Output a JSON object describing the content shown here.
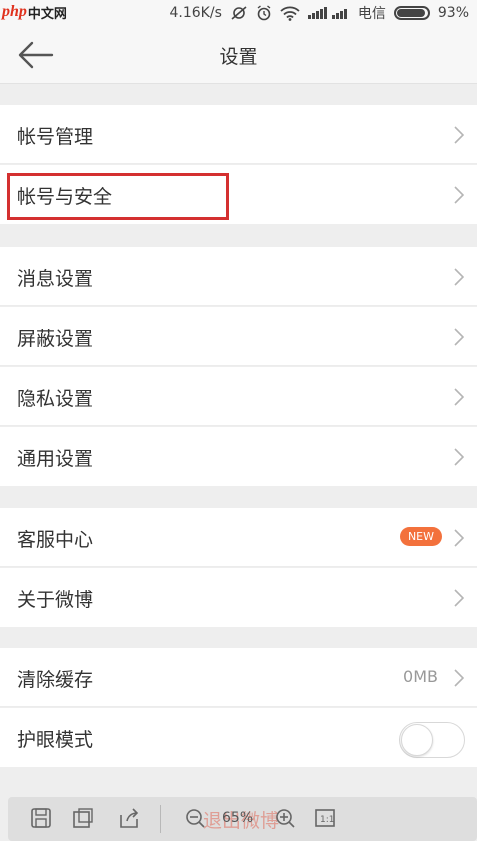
{
  "status_bar": {
    "logo_php": "php",
    "logo_cn": "中文网",
    "speed": "4.16K/s",
    "carrier": "电信",
    "battery": "93%"
  },
  "nav": {
    "title": "设置"
  },
  "settings": {
    "account_manage": "帐号管理",
    "account_security": "帐号与安全",
    "message_settings": "消息设置",
    "block_settings": "屏蔽设置",
    "privacy_settings": "隐私设置",
    "general_settings": "通用设置",
    "customer_service": "客服中心",
    "customer_service_badge": "NEW",
    "about_weibo": "关于微博",
    "clear_cache": "清除缓存",
    "cache_size": "0MB",
    "eye_care": "护眼模式",
    "eye_care_on": false
  },
  "toolbar": {
    "zoom": "65%",
    "logout": "退出微博"
  },
  "colors": {
    "accent": "#f3713c",
    "highlight": "#d43030"
  }
}
